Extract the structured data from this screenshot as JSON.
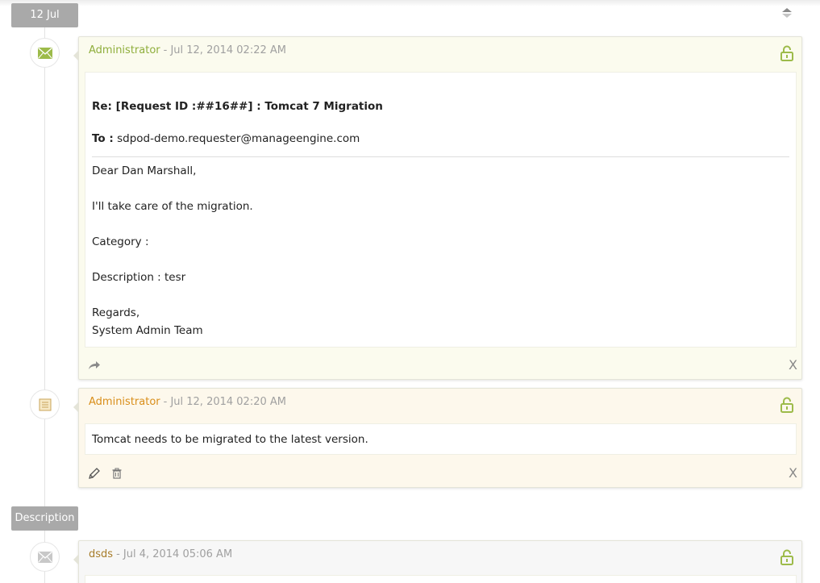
{
  "dates": {
    "first": "12 Jul",
    "second": "Description"
  },
  "entries": [
    {
      "type": "email",
      "author": "Administrator",
      "timestamp": "- Jul 12, 2014 02:22 AM",
      "subject": "Re: [Request ID :##16##] : Tomcat 7 Migration",
      "to_label": "To :",
      "to_value": "sdpod-demo.requester@manageengine.com",
      "greeting": "Dear Dan Marshall,",
      "line1": "I'll take care of the migration.",
      "line2": "Category :",
      "line3": "Description : tesr",
      "closing1": "Regards,",
      "closing2": "System Admin Team",
      "close_label": "X"
    },
    {
      "type": "note",
      "author": "Administrator",
      "timestamp": "- Jul 12, 2014 02:20 AM",
      "text": "Tomcat needs to be migrated to the latest version.",
      "close_label": "X"
    },
    {
      "type": "email",
      "author": "dsds",
      "timestamp": "- Jul 4, 2014 05:06 AM"
    }
  ],
  "icons": {
    "sort": "sort-icon",
    "mail": "envelope-icon",
    "note": "note-icon",
    "lock": "unlock-icon",
    "forward": "forward-icon",
    "edit": "pencil-icon",
    "delete": "trash-icon"
  },
  "colors": {
    "accent_green": "#8fae3c",
    "accent_orange": "#d98e1a",
    "date_pill": "#a9a9a9"
  }
}
